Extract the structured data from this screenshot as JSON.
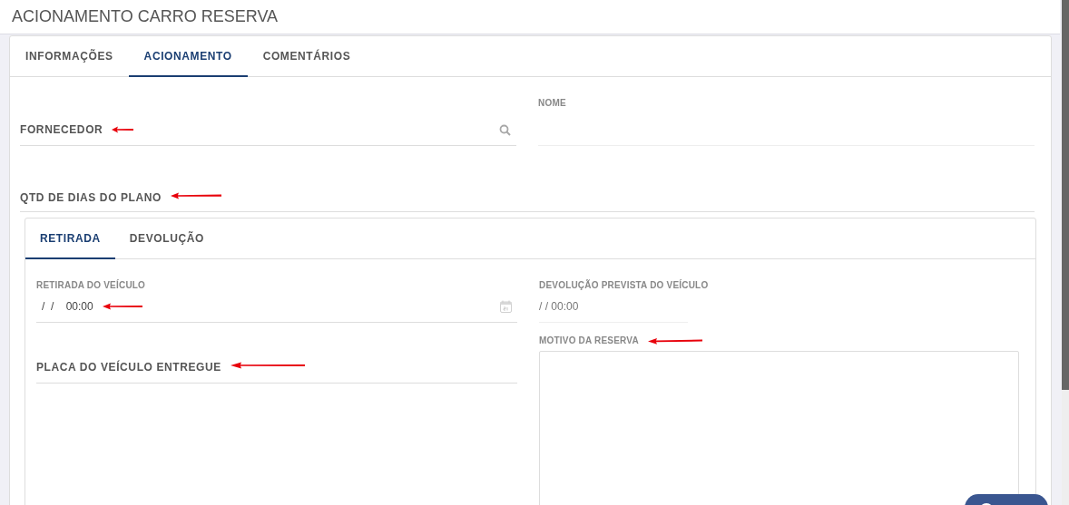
{
  "page_title": "ACIONAMENTO CARRO RESERVA",
  "tabs": [
    {
      "label": "INFORMAÇÕES",
      "selected": false
    },
    {
      "label": "ACIONAMENTO",
      "selected": true
    },
    {
      "label": "COMENTÁRIOS",
      "selected": false
    }
  ],
  "supplier": {
    "label": "FORNECEDOR",
    "annotated": true
  },
  "name": {
    "label": "NOME"
  },
  "plan_days": {
    "label": "QTD DE DIAS DO PLANO",
    "annotated": true
  },
  "inner_tabs": [
    {
      "label": "RETIRADA",
      "selected": true
    },
    {
      "label": "DEVOLUÇÃO",
      "selected": false
    }
  ],
  "pickup": {
    "label": "RETIRADA DO VEÍCULO",
    "value": "/  /    00:00",
    "annotated": true
  },
  "plate": {
    "label": "PLACA DO VEÍCULO ENTREGUE",
    "annotated": true
  },
  "expected_return": {
    "label": "DEVOLUÇÃO PREVISTA DO VEÍCULO",
    "value": "/ / 00:00"
  },
  "reason": {
    "label": "MOTIVO DA RESERVA",
    "annotated": true
  }
}
